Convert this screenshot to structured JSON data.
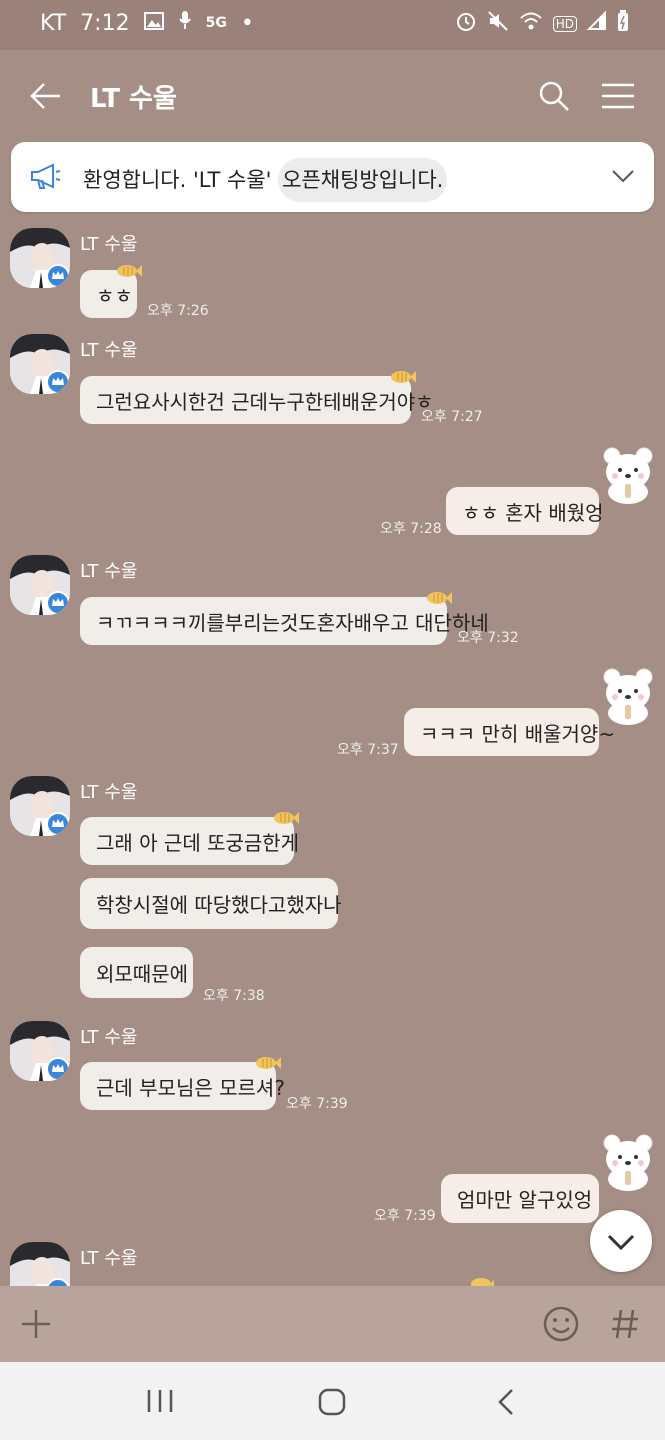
{
  "status": {
    "carrier": "KT",
    "time": "7:12",
    "network": "5G",
    "hd": "HD"
  },
  "chat": {
    "title": "LT 수울"
  },
  "notice": {
    "text_pre": "환영합니다. 'LT 수울' ",
    "text_hl": "오픈채팅방입니다."
  },
  "messages": {
    "sender": "LT 수울",
    "m1": {
      "text": "ㅎㅎ",
      "time": "오후 7:26"
    },
    "m2": {
      "text": "그런요사시한건 근데누구한테배운거야ㅎ",
      "time": "오후 7:27"
    },
    "m3": {
      "text": "ㅎㅎ 혼자 배웠엉",
      "time": "오후 7:28"
    },
    "m4": {
      "text": "ㅋㄲㅋㅋㅋ끼를부리는것도혼자배우고 대단하네",
      "time": "오후 7:32"
    },
    "m5": {
      "text": "ㅋㅋㅋ 만히 배울거양~",
      "time": "오후 7:37"
    },
    "m6a": {
      "text": "그래 아 근데 또궁금한게"
    },
    "m6b": {
      "text": "학창시절에 따당했다고했자나"
    },
    "m6c": {
      "text": "외모때문에",
      "time": "오후 7:38"
    },
    "m7": {
      "text": "근데 부모님은 모르셔?",
      "time": "오후 7:39"
    },
    "m8": {
      "text": "엄마만 알구있엉",
      "time": "오후 7:39"
    }
  },
  "colors": {
    "background": "#a58e85",
    "incoming": "#f1eee9",
    "outgoing": "#f6ece8",
    "notice": "#ffffff"
  }
}
